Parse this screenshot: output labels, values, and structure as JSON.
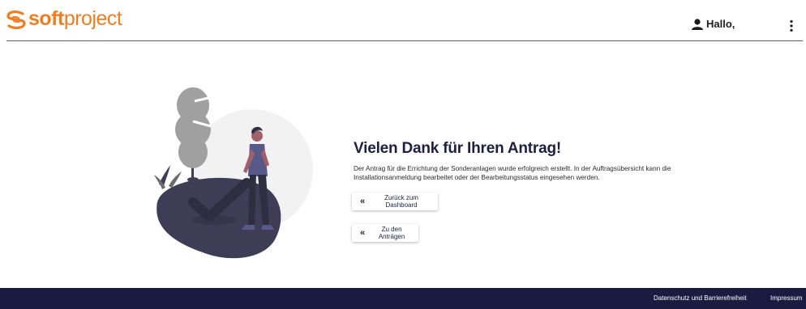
{
  "header": {
    "logo_bold": "soft",
    "logo_light": "project",
    "greeting": "Hallo,",
    "user_icon": "user-icon",
    "menu_icon": "more-vertical-icon"
  },
  "main": {
    "title": "Vielen Dank für Ihren Antrag!",
    "description": "Der Antrag für die Errichtung der Sonderanlagen wurde erfolgreich erstellt. In der Auftragsübersicht kann die Installationsanmeldung bearbeitet oder der Bearbeitungsstatus eingesehen werden.",
    "buttons": {
      "dashboard": "Zurück zum Dashboard",
      "antraege": "Zu den Anträgen",
      "chevron": "«"
    }
  },
  "footer": {
    "privacy": "Datenschutz und Barrierefreiheit",
    "imprint": "Impressum"
  },
  "colors": {
    "brand_orange": "#ef7d22",
    "navy": "#1b1b42",
    "title": "#1f1f3f"
  }
}
